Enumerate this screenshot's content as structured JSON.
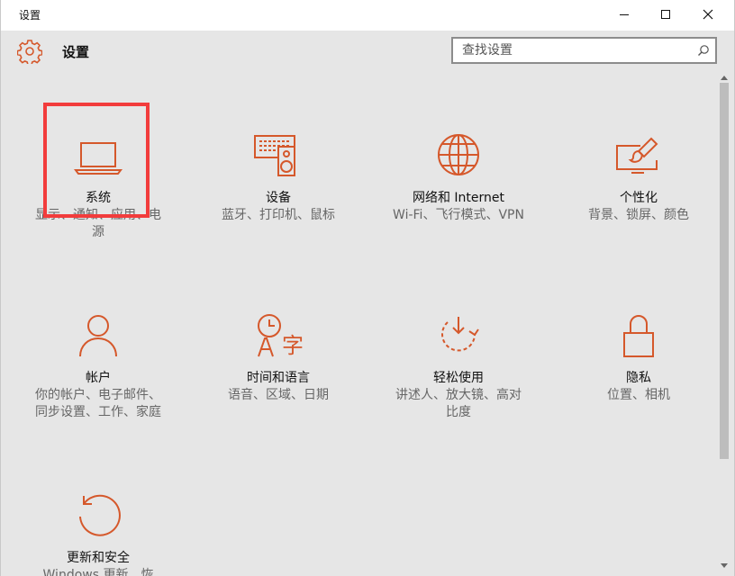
{
  "window": {
    "title": "设置"
  },
  "header": {
    "title": "设置",
    "search_placeholder": "查找设置"
  },
  "colors": {
    "accent": "#d5582b",
    "highlight": "#f23c3c"
  },
  "tiles": [
    {
      "id": "system",
      "label": "系统",
      "desc_lines": [
        "显示、通知、应用、电",
        "源"
      ],
      "icon": "laptop-icon"
    },
    {
      "id": "devices",
      "label": "设备",
      "desc_lines": [
        "蓝牙、打印机、鼠标"
      ],
      "icon": "devices-icon"
    },
    {
      "id": "network",
      "label": "网络和 Internet",
      "desc_lines": [
        "Wi-Fi、飞行模式、VPN"
      ],
      "icon": "globe-icon"
    },
    {
      "id": "personalization",
      "label": "个性化",
      "desc_lines": [
        "背景、锁屏、颜色"
      ],
      "icon": "paint-icon"
    },
    {
      "id": "accounts",
      "label": "帐户",
      "desc_lines": [
        "你的帐户、电子邮件、",
        "同步设置、工作、家庭"
      ],
      "icon": "person-icon"
    },
    {
      "id": "time-language",
      "label": "时间和语言",
      "desc_lines": [
        "语音、区域、日期"
      ],
      "icon": "time-language-icon"
    },
    {
      "id": "ease-of-access",
      "label": "轻松使用",
      "desc_lines": [
        "讲述人、放大镜、高对",
        "比度"
      ],
      "icon": "ease-of-access-icon"
    },
    {
      "id": "privacy",
      "label": "隐私",
      "desc_lines": [
        "位置、相机"
      ],
      "icon": "lock-icon"
    },
    {
      "id": "update-security",
      "label": "更新和安全",
      "desc_lines": [
        "Windows 更新、恢"
      ],
      "icon": "refresh-icon"
    }
  ]
}
